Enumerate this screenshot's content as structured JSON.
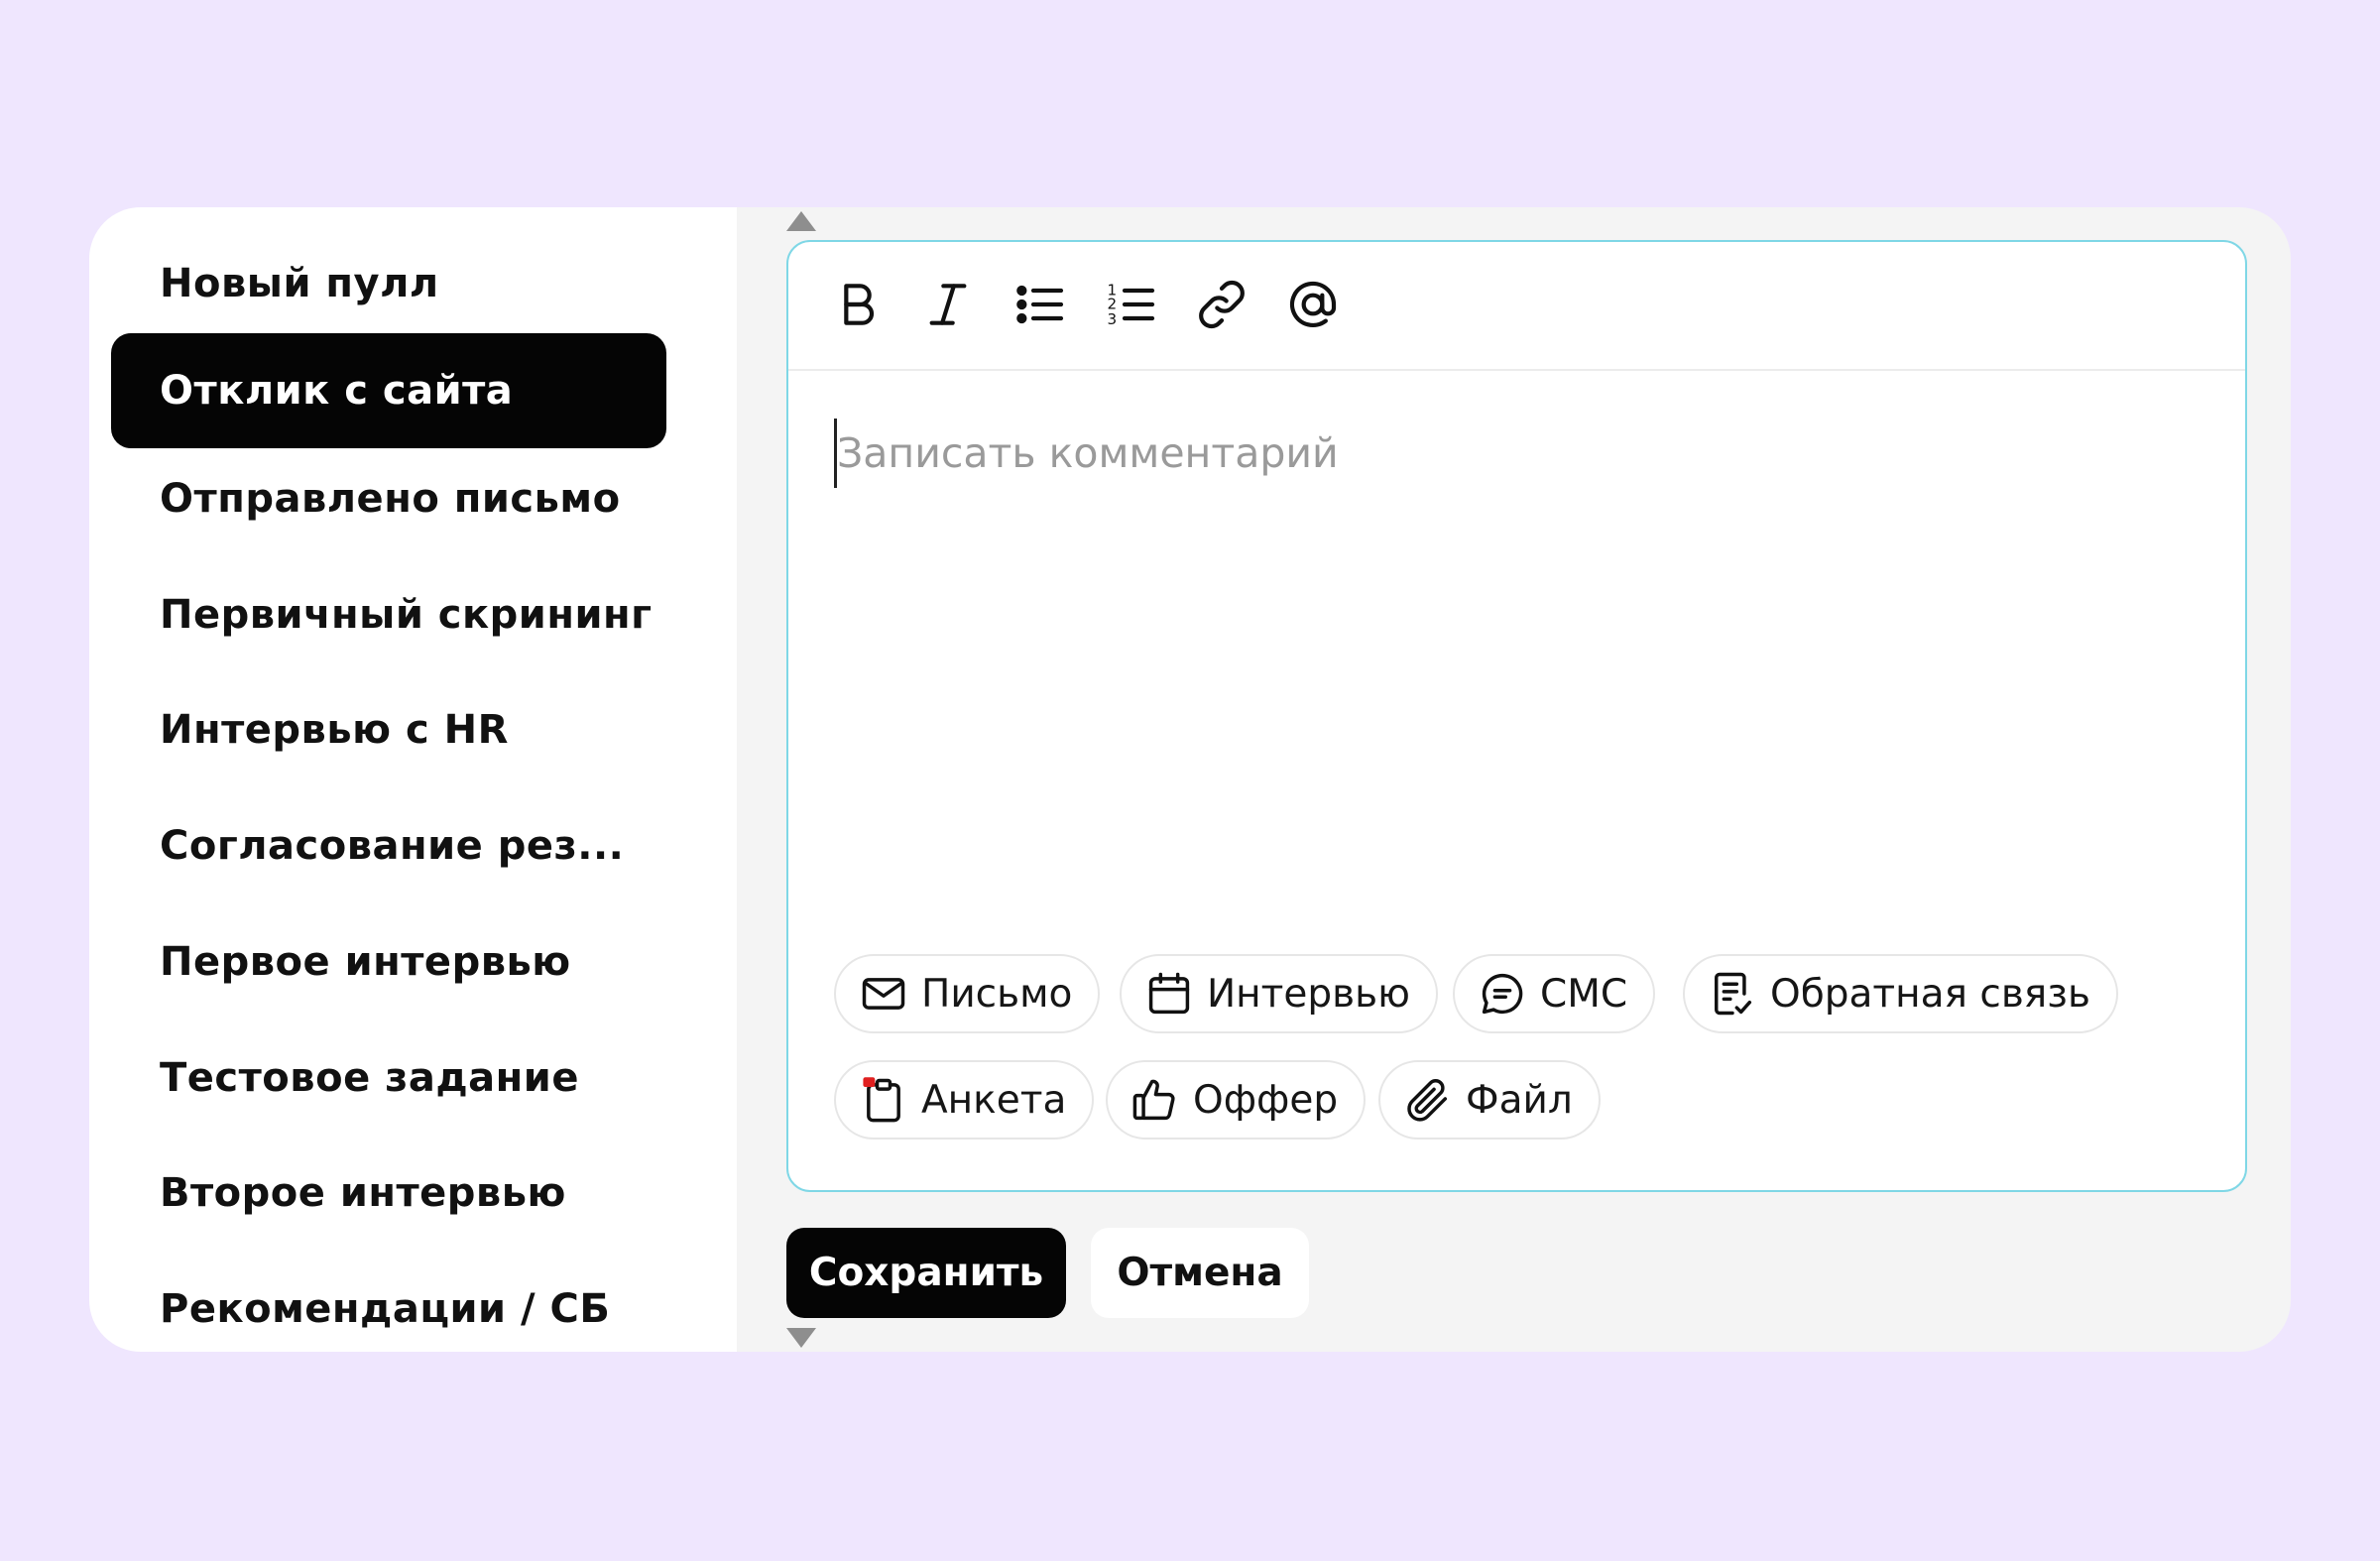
{
  "stages": {
    "items": [
      {
        "label": "Новый пулл",
        "active": false
      },
      {
        "label": "Отклик с сайта",
        "active": true
      },
      {
        "label": "Отправлено письмо",
        "active": false
      },
      {
        "label": "Первичный скрининг",
        "active": false
      },
      {
        "label": "Интервью с HR",
        "active": false
      },
      {
        "label": "Согласование рез...",
        "active": false
      },
      {
        "label": "Первое интервью",
        "active": false
      },
      {
        "label": "Тестовое задание",
        "active": false
      },
      {
        "label": "Второе интервью",
        "active": false
      },
      {
        "label": "Рекомендации / СБ",
        "active": false
      }
    ]
  },
  "toolbar": {
    "tools": [
      "bold-icon",
      "italic-icon",
      "bullet-list-icon",
      "numbered-list-icon",
      "link-icon",
      "mention-icon"
    ]
  },
  "editor": {
    "value": "",
    "placeholder": "Записать комментарий"
  },
  "actions": {
    "letter": "Письмо",
    "interview": "Интервью",
    "sms": "СМС",
    "feedback": "Обратная связь",
    "survey": "Анкета",
    "offer": "Оффер",
    "file": "Файл"
  },
  "buttons": {
    "save": "Сохранить",
    "cancel": "Отмена"
  },
  "colors": {
    "background": "#efe6fe",
    "active_stage": "#050505",
    "editor_focus_border": "#7fd7e6",
    "survey_badge": "#e02020"
  }
}
